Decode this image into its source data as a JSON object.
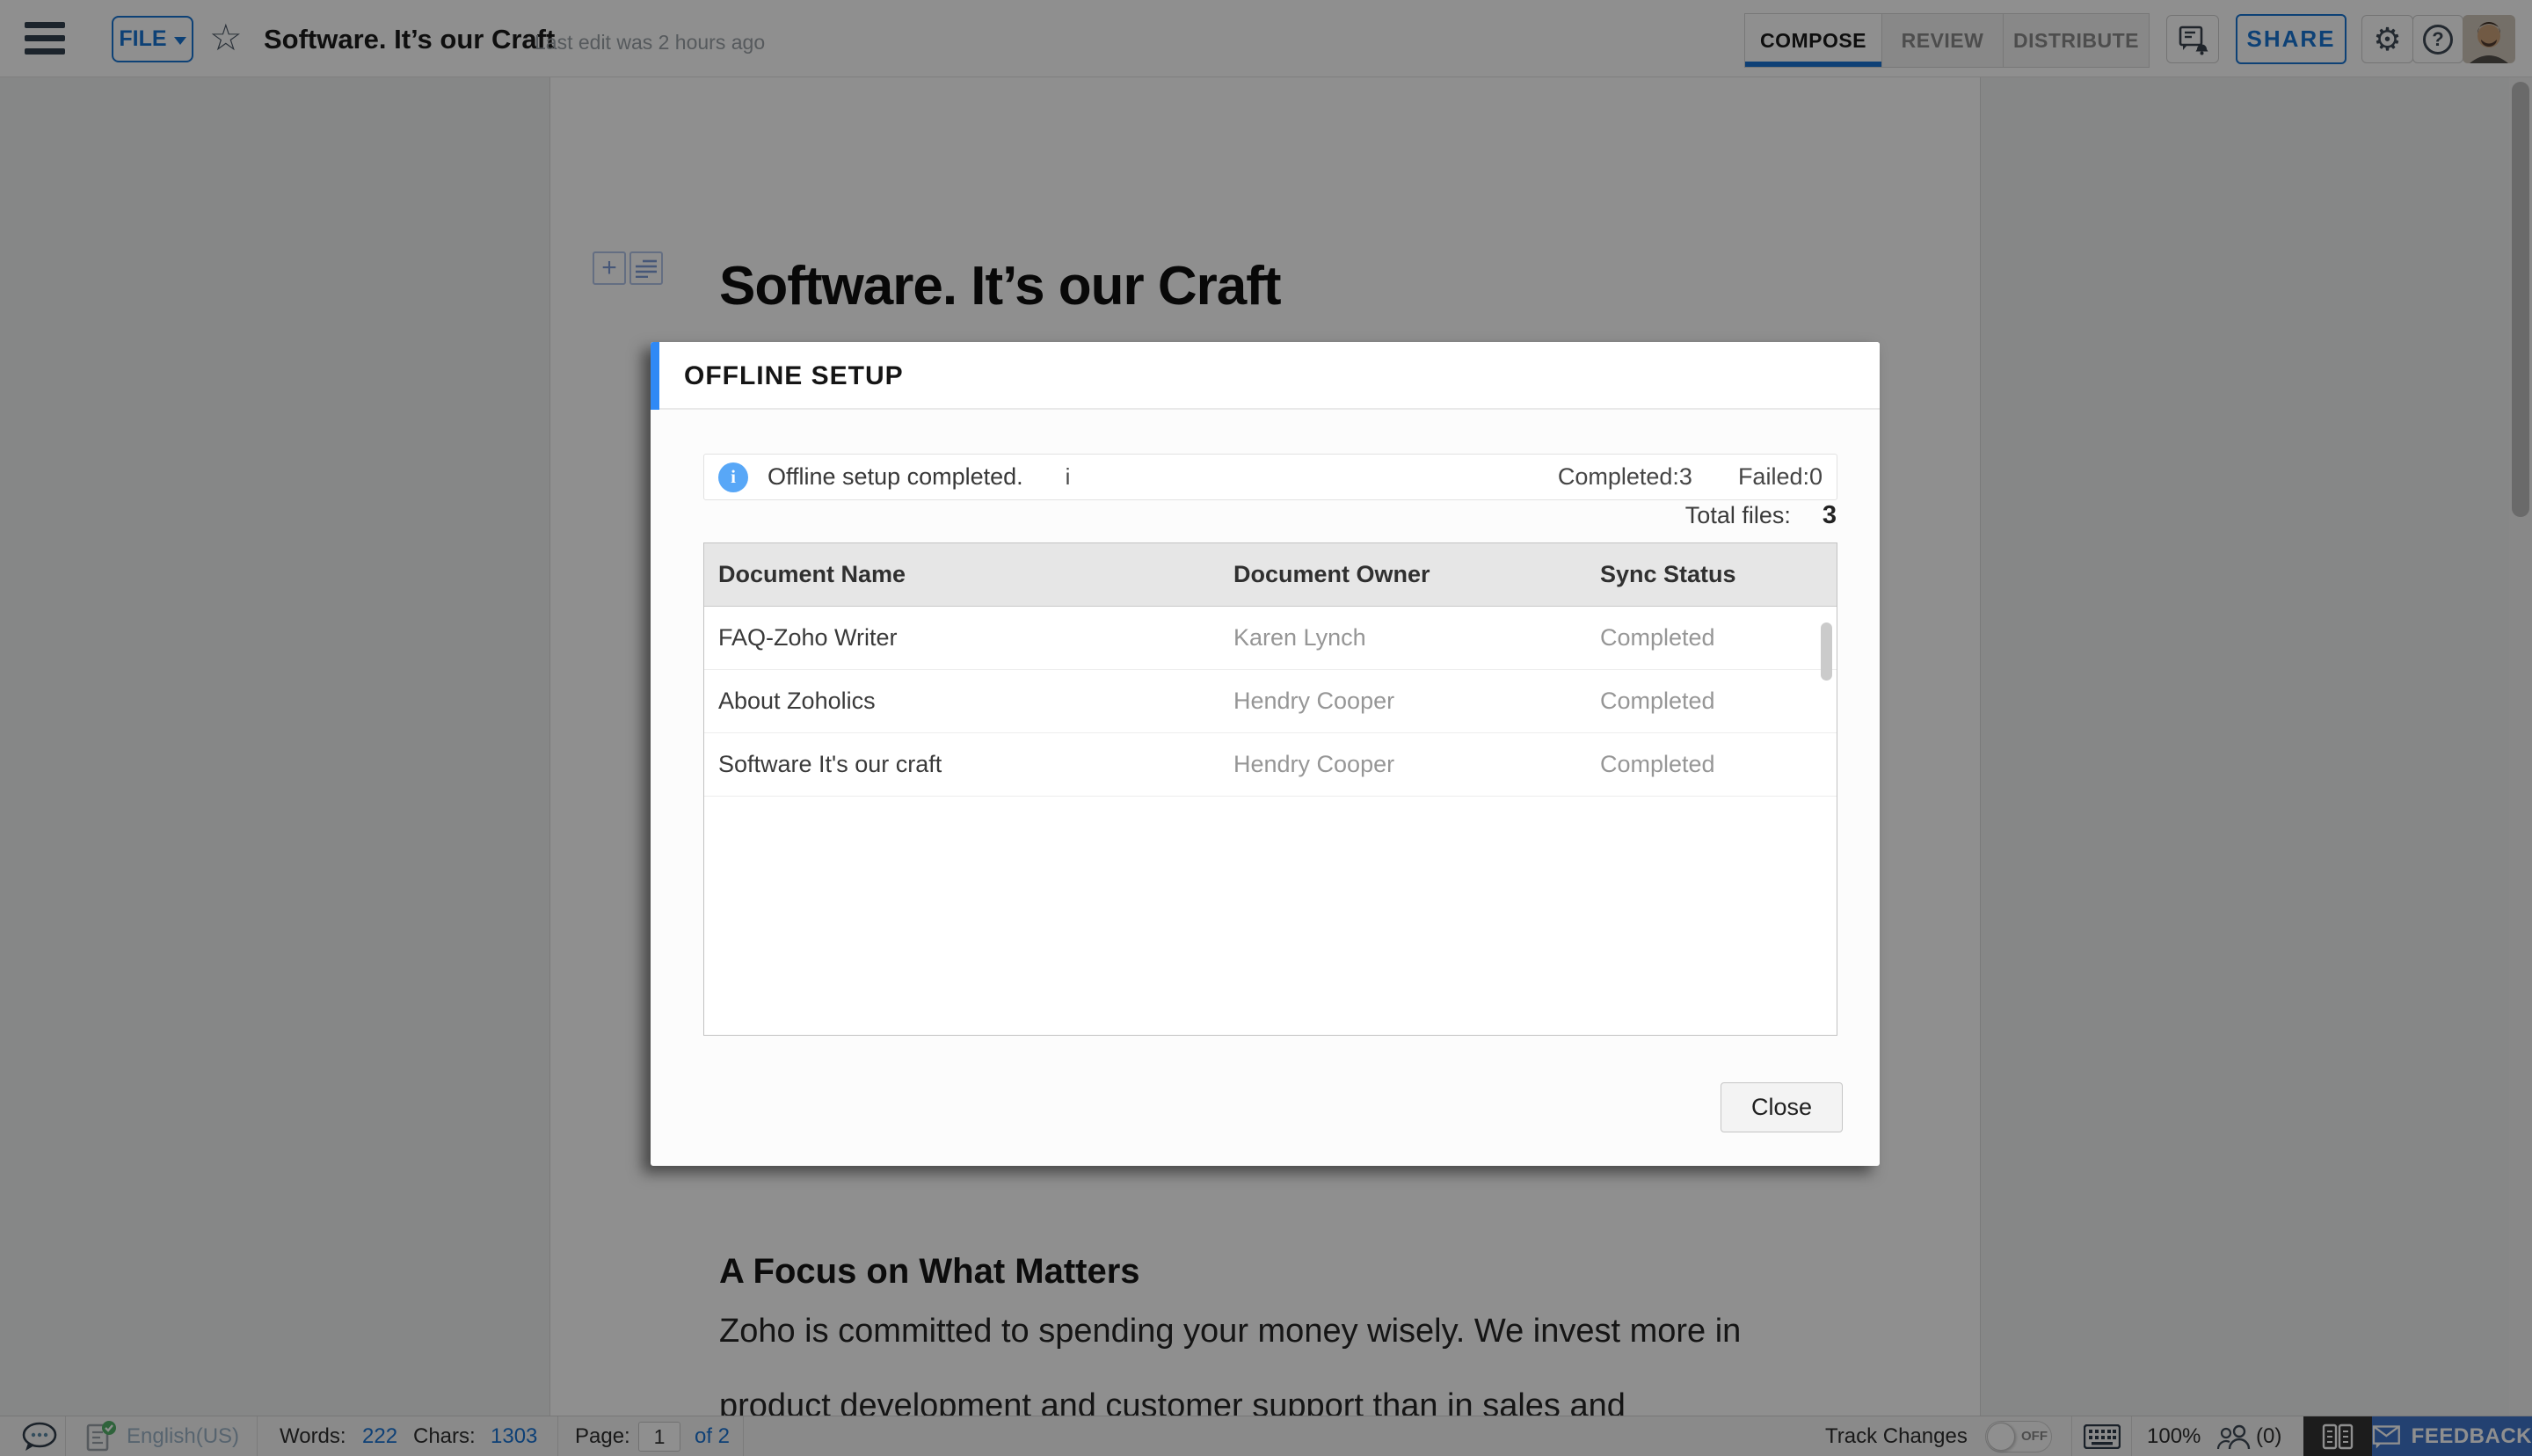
{
  "header": {
    "file_button": "FILE",
    "doc_title": "Software. It’s our Craft",
    "last_edit": "Last edit was 2 hours ago",
    "tabs": [
      {
        "label": "COMPOSE"
      },
      {
        "label": "REVIEW"
      },
      {
        "label": "DISTRIBUTE"
      }
    ],
    "share_label": "SHARE"
  },
  "document": {
    "title": "Software. It’s our Craft",
    "heading": "A Focus on What Matters",
    "para_line1": "Zoho is committed to spending your money wisely. We invest more in",
    "para_line2": "product development and customer support than in sales and"
  },
  "modal": {
    "title": "OFFLINE SETUP",
    "status_message": "Offline setup completed.",
    "cursor_char": "i",
    "completed_label": "Completed:3",
    "failed_label": "Failed:0",
    "total_files_label": "Total files:",
    "total_files_value": "3",
    "table": {
      "columns": [
        "Document Name",
        "Document Owner",
        "Sync Status"
      ],
      "rows": [
        {
          "name": "FAQ-Zoho Writer",
          "owner": "Karen Lynch",
          "status": "Completed"
        },
        {
          "name": "About Zoholics",
          "owner": "Hendry Cooper",
          "status": "Completed"
        },
        {
          "name": "Software It's our craft",
          "owner": "Hendry Cooper",
          "status": "Completed"
        }
      ]
    },
    "close_label": "Close"
  },
  "statusbar": {
    "language": "English(US)",
    "words_label": "Words:",
    "words_value": "222",
    "chars_label": "Chars:",
    "chars_value": "1303",
    "page_label": "Page:",
    "page_value": "1",
    "page_of": "of 2",
    "track_changes_label": "Track Changes",
    "track_changes_state": "OFF",
    "zoom_level": "100%",
    "collab_count": "(0)",
    "feedback_label": "FEEDBACK"
  },
  "colors": {
    "accent_blue": "#1a73d2",
    "modal_accent": "#2f89f5",
    "info_icon_blue": "#58a7f7",
    "feedback_bg": "#3f74c9",
    "overlay": "rgba(0,0,0,0.44)"
  }
}
